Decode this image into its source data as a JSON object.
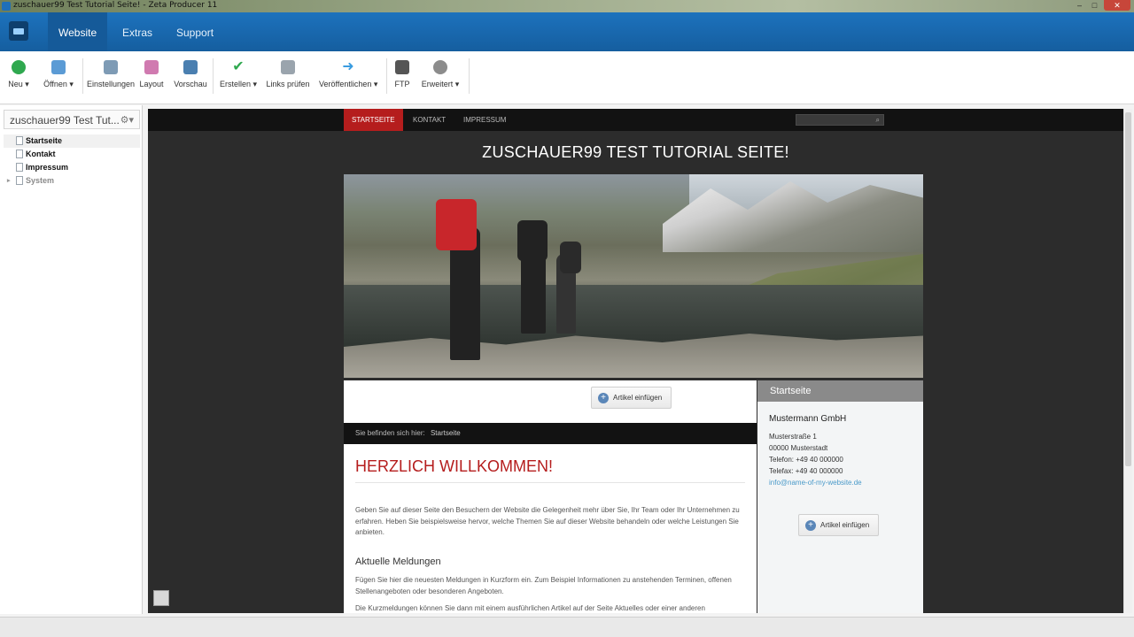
{
  "window": {
    "title": "zuschauer99 Test Tutorial Seite! - Zeta Producer 11",
    "controls": [
      "–",
      "□",
      "✕"
    ]
  },
  "ribbon": {
    "tabs": [
      "Website",
      "Extras",
      "Support"
    ],
    "active": "Website"
  },
  "toolbar": {
    "items": [
      {
        "label": "Neu ▾",
        "icon": "new-icon",
        "color": "#2fa84f"
      },
      {
        "label": "Öffnen ▾",
        "icon": "folder-icon",
        "color": "#5b9bd5"
      },
      {
        "label": "Einstellungen",
        "icon": "settings-icon",
        "color": "#7e9bb5"
      },
      {
        "label": "Layout",
        "icon": "layout-icon",
        "color": "#d07ab0"
      },
      {
        "label": "Vorschau",
        "icon": "monitor-icon",
        "color": "#4a7fb0"
      },
      {
        "label": "Erstellen ▾",
        "icon": "check-icon",
        "color": "#2fa84f"
      },
      {
        "label": "Links prüfen",
        "icon": "links-icon",
        "color": "#9aa4ad"
      },
      {
        "label": "Veröffentlichen ▾",
        "icon": "arrow-right-icon",
        "color": "#3a9ce0"
      },
      {
        "label": "FTP",
        "icon": "ftp-icon",
        "color": "#555"
      },
      {
        "label": "Erweitert ▾",
        "icon": "gear-icon",
        "color": "#8c8c8c"
      }
    ]
  },
  "sidebar": {
    "project": "zuschauer99 Test Tut...",
    "gear": "⚙▾",
    "pages": [
      {
        "label": "Startseite"
      },
      {
        "label": "Kontakt"
      },
      {
        "label": "Impressum"
      },
      {
        "label": "System"
      }
    ]
  },
  "site": {
    "nav": [
      "STARTSEITE",
      "KONTAKT",
      "IMPRESSUM"
    ],
    "search_icon": "⌕",
    "title": "ZUSCHAUER99 TEST TUTORIAL SEITE!",
    "insert_button": "Artikel einfügen",
    "breadcrumb_prefix": "Sie befinden sich hier:",
    "breadcrumb_current": "Startseite",
    "welcome": "HERZLICH WILLKOMMEN!",
    "intro": "Geben Sie auf dieser Seite den Besuchern der Website die Gelegenheit mehr über Sie, Ihr Team oder Ihr Unternehmen zu erfahren. Heben Sie beispielsweise hervor, welche Themen Sie auf dieser Website behandeln oder welche Leistungen Sie anbieten.",
    "news_heading": "Aktuelle Meldungen",
    "news_text": "Fügen Sie hier die neuesten Meldungen in Kurzform ein. Zum Beispiel Informationen zu anstehenden Terminen, offenen Stellenangeboten oder besonderen Angeboten.",
    "news_text2": "Die Kurzmeldungen können Sie dann mit einem ausführlichen Artikel auf der Seite Aktuelles oder einer anderen",
    "sidebar_heading": "Startseite",
    "company": "Mustermann GmbH",
    "street": "Musterstraße 1",
    "city": "00000 Musterstadt",
    "phone": "Telefon: +49 40 000000",
    "fax": "Telefax: +49 40 000000",
    "email": "info@name-of-my-website.de"
  }
}
